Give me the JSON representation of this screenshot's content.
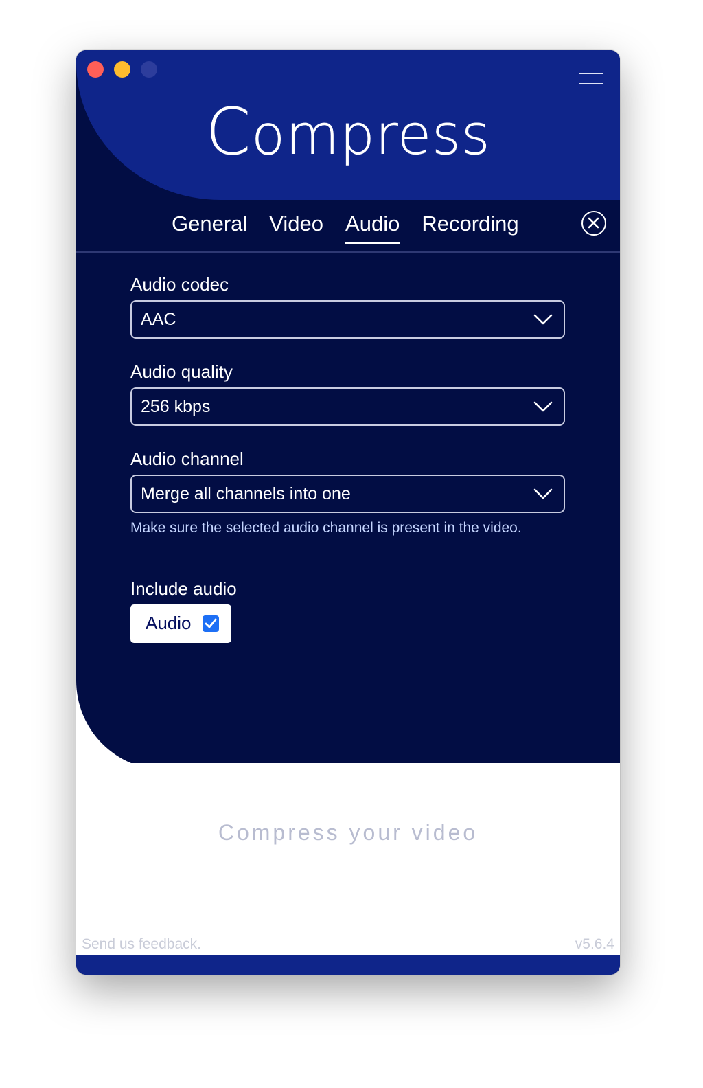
{
  "app": {
    "title_first": "C",
    "title_rest": "ompress"
  },
  "tabs": [
    {
      "label": "General",
      "active": false
    },
    {
      "label": "Video",
      "active": false
    },
    {
      "label": "Audio",
      "active": true
    },
    {
      "label": "Recording",
      "active": false
    }
  ],
  "audio": {
    "codec": {
      "label": "Audio codec",
      "value": "AAC"
    },
    "quality": {
      "label": "Audio quality",
      "value": "256 kbps"
    },
    "channel": {
      "label": "Audio channel",
      "value": "Merge all channels into one",
      "hint": "Make sure the selected audio channel is present in the video."
    },
    "include": {
      "label": "Include audio",
      "checkbox_label": "Audio",
      "checked": true
    }
  },
  "footer": {
    "cta": "Compress your video",
    "feedback": "Send us feedback.",
    "version": "v5.6.4"
  },
  "colors": {
    "header_blue": "#0f258a",
    "panel_navy": "#020d44",
    "checkbox_blue": "#1d6ff5"
  }
}
